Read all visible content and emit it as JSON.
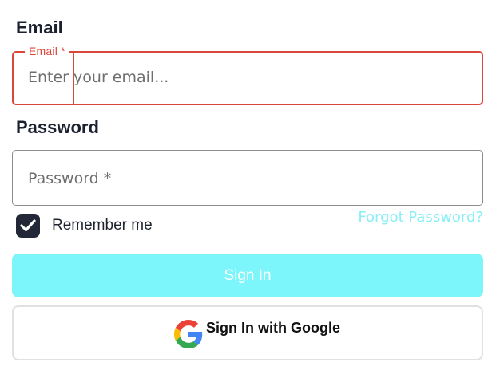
{
  "email": {
    "heading": "Email",
    "legend": "Email *",
    "placeholder": "Enter your email...",
    "value": ""
  },
  "password": {
    "heading": "Password",
    "placeholder": "Password *",
    "value": ""
  },
  "remember": {
    "label": "Remember me",
    "checked": true
  },
  "forgot_link": "Forgot Password?",
  "signin_button": "Sign In",
  "google_button": {
    "label": "Sign In with Google",
    "icon": "google-logo-icon"
  },
  "colors": {
    "error_red": "#d9473b",
    "accent_cyan": "#7cf5fb",
    "link_cyan": "#86f0f6",
    "checkbox_dark": "#222838",
    "heading_dark": "#1c2130"
  }
}
